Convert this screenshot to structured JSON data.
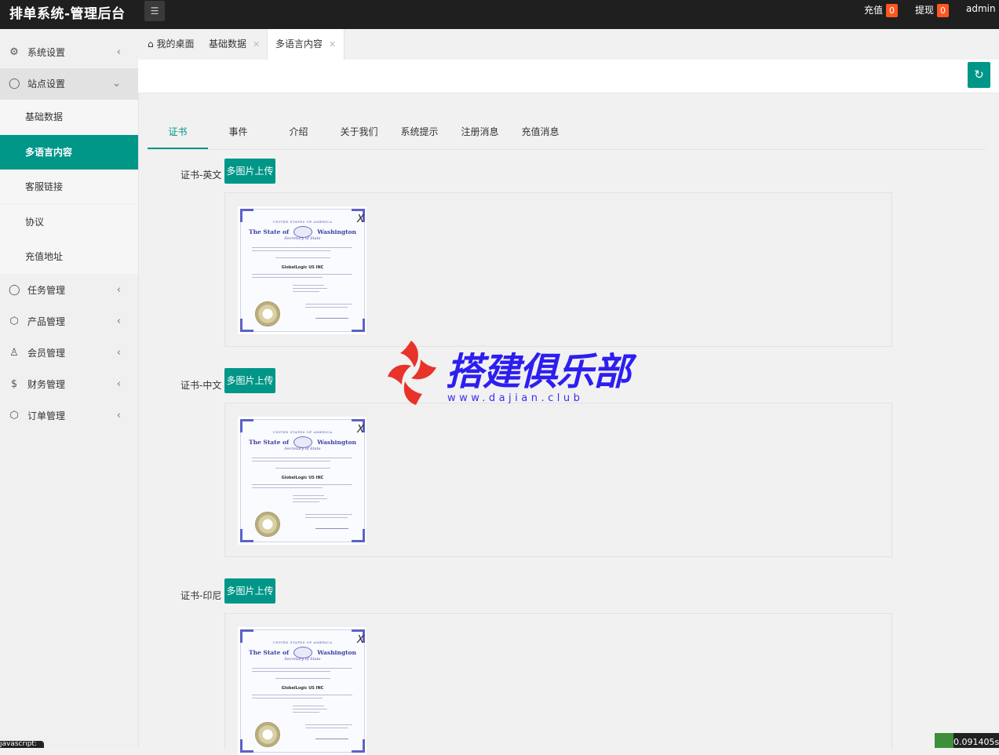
{
  "app": {
    "title": "排单系统-管理后台"
  },
  "topbar": {
    "menu_icon": "list-icon",
    "recharge": {
      "label": "充值",
      "count": "0"
    },
    "withdraw": {
      "label": "提现",
      "count": "0"
    },
    "user": "admin"
  },
  "sidebar": {
    "items": [
      {
        "label": "系统设置",
        "icon": "gear-icon"
      },
      {
        "label": "站点设置",
        "icon": "bell-icon",
        "open": true
      },
      {
        "label": "任务管理",
        "icon": "bell-icon"
      },
      {
        "label": "产品管理",
        "icon": "cube-icon"
      },
      {
        "label": "会员管理",
        "icon": "user-icon"
      },
      {
        "label": "财务管理",
        "icon": "dollar-icon"
      },
      {
        "label": "订单管理",
        "icon": "cube-icon"
      }
    ],
    "sub_items": [
      {
        "label": "基础数据"
      },
      {
        "label": "多语言内容",
        "active": true
      },
      {
        "label": "客服链接"
      },
      {
        "label": "协议"
      },
      {
        "label": "充值地址"
      }
    ]
  },
  "page_tabs": [
    {
      "label": "我的桌面",
      "icon": "home-icon"
    },
    {
      "label": "基础数据"
    },
    {
      "label": "多语言内容",
      "active": true
    }
  ],
  "toolbar": {
    "refresh_icon": "refresh-icon"
  },
  "content_tabs": [
    {
      "label": "证书",
      "active": true
    },
    {
      "label": "事件"
    },
    {
      "label": "介绍"
    },
    {
      "label": "关于我们"
    },
    {
      "label": "系统提示"
    },
    {
      "label": "注册消息"
    },
    {
      "label": "充值消息"
    }
  ],
  "upload_button_label": "多图片上传",
  "remove_label": "X",
  "certificate": {
    "top_line": "UNITED STATES OF AMERICA",
    "left_head": "The State of",
    "right_head": "Washington",
    "sub_line": "Secretary of State",
    "company": "GlobelLogic US INC"
  },
  "sections": [
    {
      "label": "证书-英文"
    },
    {
      "label": "证书-中文"
    },
    {
      "label": "证书-印尼"
    }
  ],
  "watermark": {
    "brand": "搭建俱乐部",
    "url": "www.dajian.club"
  },
  "footer": {
    "js_tag": "javascript:",
    "timer": "0.091405s"
  },
  "colors": {
    "accent": "#009688",
    "topbar": "#1f1f1f",
    "badge": "#ff5722",
    "watermark": "#2d1ef0"
  }
}
